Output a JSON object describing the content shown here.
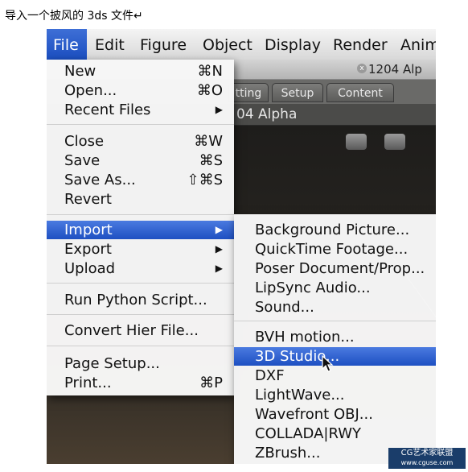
{
  "caption": "导入一个披风的 3ds 文件↵",
  "menubar": {
    "items": [
      "File",
      "Edit",
      "Figure",
      "Object",
      "Display",
      "Render",
      "Anim"
    ]
  },
  "window": {
    "title": "1204 Alp",
    "close_symbol": "x"
  },
  "tabs": [
    "tting",
    "Setup",
    "Content"
  ],
  "document_label": "04 Alpha",
  "file_menu": {
    "groups": [
      [
        {
          "label": "New",
          "shortcut": "⌘N"
        },
        {
          "label": "Open...",
          "shortcut": "⌘O"
        },
        {
          "label": "Recent Files",
          "submenu": "▶"
        }
      ],
      [
        {
          "label": "Close",
          "shortcut": "⌘W"
        },
        {
          "label": "Save",
          "shortcut": "⌘S"
        },
        {
          "label": "Save As...",
          "shortcut": "⇧⌘S"
        },
        {
          "label": "Revert"
        }
      ],
      [
        {
          "label": "Import",
          "submenu": "▶",
          "highlighted": true
        },
        {
          "label": "Export",
          "submenu": "▶"
        },
        {
          "label": "Upload",
          "submenu": "▶"
        }
      ],
      [
        {
          "label": "Run Python Script..."
        }
      ],
      [
        {
          "label": "Convert Hier File..."
        }
      ],
      [
        {
          "label": "Page Setup..."
        },
        {
          "label": "Print...",
          "shortcut": "⌘P"
        }
      ]
    ]
  },
  "import_menu": {
    "groups": [
      [
        {
          "label": "Background Picture..."
        },
        {
          "label": "QuickTime Footage..."
        },
        {
          "label": "Poser Document/Prop..."
        },
        {
          "label": "LipSync Audio..."
        },
        {
          "label": "Sound..."
        }
      ],
      [
        {
          "label": "BVH motion..."
        },
        {
          "label": "3D Studio...",
          "highlighted": true
        },
        {
          "label": "DXF"
        },
        {
          "label": "LightWave..."
        },
        {
          "label": "Wavefront OBJ..."
        },
        {
          "label": "COLLADA|RWY"
        },
        {
          "label": "ZBrush..."
        }
      ]
    ]
  },
  "watermark": {
    "line1": "CG艺术家联盟",
    "line2": "www.cguse.com"
  },
  "colors": {
    "highlight": "#1e50c2",
    "menu_bg": "#f7f7f7",
    "viewport": "#1e1d1b"
  }
}
